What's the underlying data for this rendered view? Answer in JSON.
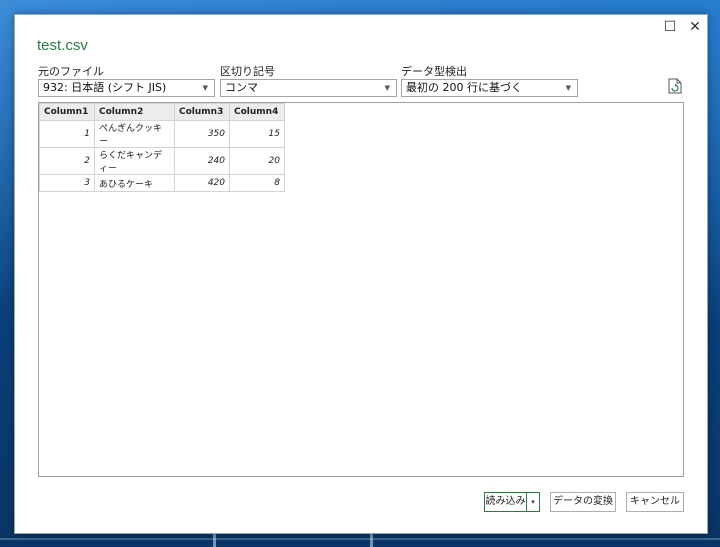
{
  "dialog": {
    "title": "test.csv",
    "window_buttons": {
      "maximize": "☐",
      "close": "✕"
    }
  },
  "options": {
    "file_origin": {
      "label": "元のファイル",
      "value": "932: 日本語 (シフト JIS)"
    },
    "delimiter": {
      "label": "区切り記号",
      "value": "コンマ"
    },
    "type_detection": {
      "label": "データ型検出",
      "value": "最初の 200 行に基づく"
    }
  },
  "table": {
    "headers": [
      "Column1",
      "Column2",
      "Column3",
      "Column4"
    ],
    "rows": [
      [
        "1",
        "ぺんぎんクッキー",
        "350",
        "15"
      ],
      [
        "2",
        "らくだキャンディー",
        "240",
        "20"
      ],
      [
        "3",
        "あひるケーキ",
        "420",
        "8"
      ]
    ]
  },
  "buttons": {
    "load": "読み込み",
    "load_dropdown": "▾",
    "transform": "データの変換",
    "cancel": "キャンセル"
  },
  "colors": {
    "accent": "#2a7a45",
    "desktop": "#0d4a86"
  }
}
